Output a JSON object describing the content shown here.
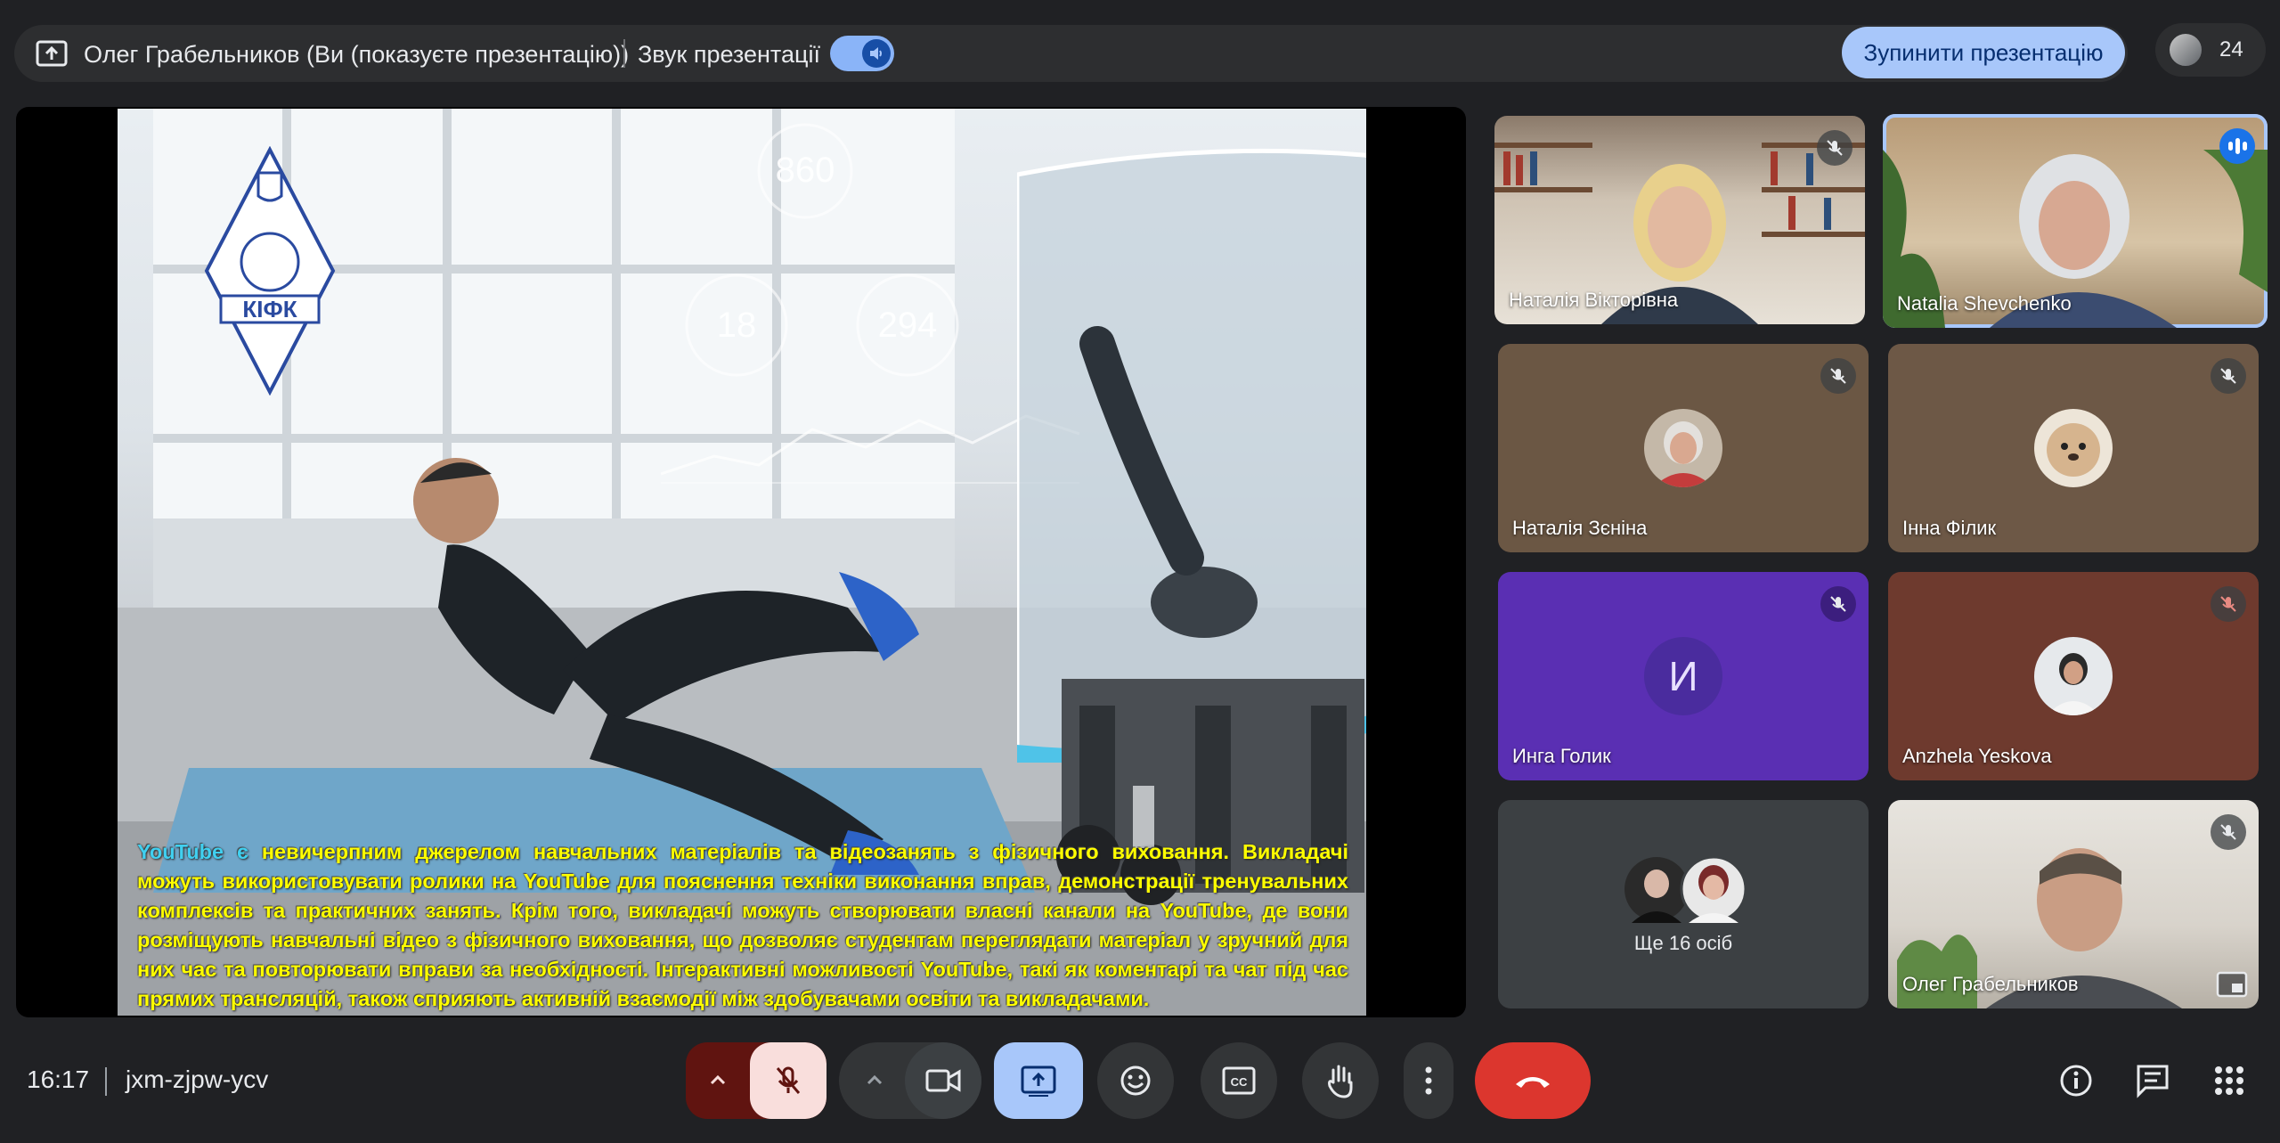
{
  "topbar": {
    "presenter_label": "Олег Грабельников (Ви (показуєте презентацію))",
    "sound_label": "Звук презентації",
    "sound_on": true,
    "stop_presenting_label": "Зупинити презентацію",
    "participant_count": "24"
  },
  "slide": {
    "hud_values": [
      "860",
      "18",
      "294"
    ],
    "logo_text": "КІФК",
    "text_lead": "YouTube є",
    "text_body": " невичерпним джерелом навчальних матеріалів та відеозанять з фізичного виховання. Викладачі можуть використовувати ролики на YouTube для пояснення техніки виконання вправ, демонстрації тренувальних комплексів та практичних занять. Крім того, викладачі можуть створювати власні канали на YouTube, де вони розміщують навчальні відео з фізичного виховання, що дозволяє студентам переглядати матеріал у зручний для них час та повторювати вправи за необхідності. Інтерактивні можливості YouTube, такі як коментарі та чат під час прямих трансляцій, також сприяють активній взаємодії між здобувачами освіти та викладачами."
  },
  "tiles": {
    "t1": {
      "name": "Наталія Вікторівна",
      "muted": true
    },
    "t2": {
      "name": "Natalia Shevchenko",
      "speaking": true
    },
    "t3": {
      "name": "Наталія Зєніна",
      "muted": true
    },
    "t4": {
      "name": "Інна Філик",
      "muted": true
    },
    "t5": {
      "name": "Инга Голик",
      "initial": "И",
      "muted": true
    },
    "t6": {
      "name": "Anzhela Yeskova",
      "muted": true
    },
    "t7": {
      "more_label": "Ще 16 осіб"
    },
    "t8": {
      "name": "Олег Грабельников",
      "muted": true
    }
  },
  "bottombar": {
    "time": "16:17",
    "meeting_code": "jxm-zjpw-ycv"
  },
  "colors": {
    "accent": "#a8c7fa",
    "leave": "#dc362e",
    "mic_off_bg": "#f9dedc",
    "slide_text": "#ffff00",
    "slide_text_youtube": "#40d0f0"
  },
  "icons": [
    "present-screen-icon",
    "volume-icon",
    "mic-off-icon",
    "speaking-icon",
    "chevron-up-icon",
    "camera-icon",
    "present-to-all-icon",
    "emoji-icon",
    "captions-icon",
    "raise-hand-icon",
    "more-vert-icon",
    "call-end-icon",
    "info-icon",
    "chat-icon",
    "apps-icon",
    "move-icon",
    "fullscreen-icon",
    "share-icon",
    "pip-icon"
  ]
}
